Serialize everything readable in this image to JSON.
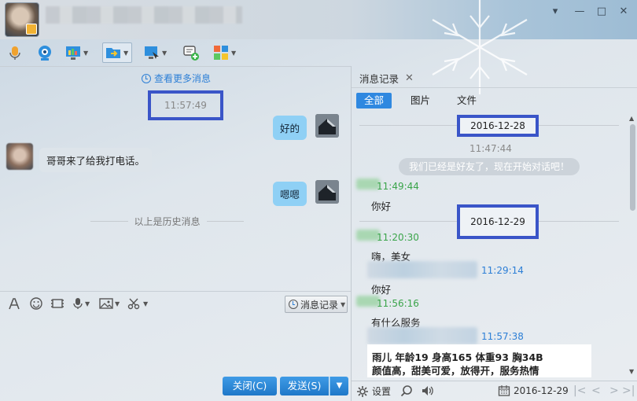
{
  "window": {
    "minimize": "—",
    "restore": "□",
    "close": "✕",
    "more": "▾"
  },
  "chat": {
    "view_more": "查看更多消息",
    "time_top": "11:57:49",
    "messages": [
      {
        "from": "me",
        "text": "好的"
      },
      {
        "from": "other",
        "text": "哥哥来了给我打电话。"
      },
      {
        "from": "me",
        "text": "嗯嗯"
      }
    ],
    "history_sep": "以上是历史消息"
  },
  "input": {
    "history_button": "消息记录",
    "close_button": "关闭(C)",
    "send_button": "发送(S)"
  },
  "history": {
    "tab_label": "消息记录",
    "filters": [
      "全部",
      "图片",
      "文件"
    ],
    "date1": "2016-12-28",
    "time1": "11:47:44",
    "system_msg": "我们已经是好友了，现在开始对话吧！",
    "t_green1": "11:49:44",
    "msg1": "你好",
    "date2": "2016-12-29",
    "t_green2": "11:20:30",
    "msg2": "嗨，美女",
    "t_blue1": "11:29:14",
    "msg3": "你好",
    "t_green3": "11:56:16",
    "msg4": "有什么服务",
    "t_blue2": "11:57:38",
    "card_line1": "雨儿  年龄19  身高165  体重93  胸34B",
    "card_line2": "颜值高，甜美可爱，放得开，服务热情"
  },
  "footer": {
    "settings": "设置",
    "date": "2016-12-29",
    "pager": [
      "|<",
      "<",
      ">",
      ">|"
    ]
  }
}
